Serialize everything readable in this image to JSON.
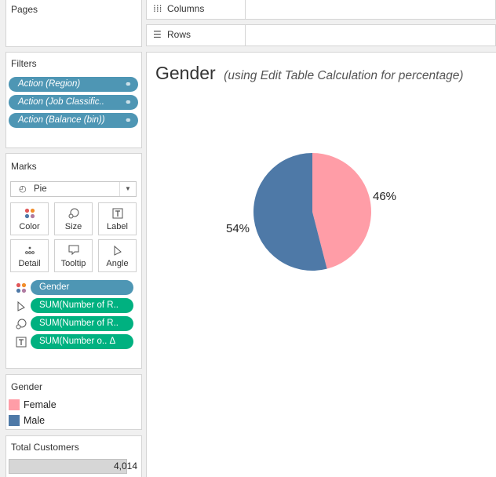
{
  "pages": {
    "title": "Pages"
  },
  "shelves": {
    "columns": {
      "icon": "columns-icon",
      "label": "Columns"
    },
    "rows": {
      "icon": "rows-icon",
      "label": "Rows"
    }
  },
  "filters": {
    "title": "Filters",
    "items": [
      {
        "label": "Action (Region)"
      },
      {
        "label": "Action (Job Classific.."
      },
      {
        "label": "Action (Balance (bin))"
      }
    ]
  },
  "marks": {
    "title": "Marks",
    "type": "Pie",
    "buttons": [
      {
        "label": "Color",
        "icon": "color-dots-icon"
      },
      {
        "label": "Size",
        "icon": "size-icon"
      },
      {
        "label": "Label",
        "icon": "label-icon"
      },
      {
        "label": "Detail",
        "icon": "detail-icon"
      },
      {
        "label": "Tooltip",
        "icon": "tooltip-icon"
      },
      {
        "label": "Angle",
        "icon": "angle-icon"
      }
    ],
    "pills": [
      {
        "label": "Gender",
        "icon": "color-dots-icon",
        "color": "#4e96b4"
      },
      {
        "label": "SUM(Number of R..",
        "icon": "angle-icon",
        "color": "#00b180"
      },
      {
        "label": "SUM(Number of R..",
        "icon": "size-icon",
        "color": "#00b180"
      },
      {
        "label": "SUM(Number o.. Δ",
        "icon": "label-icon",
        "color": "#00b180"
      }
    ]
  },
  "gender_legend": {
    "title": "Gender",
    "items": [
      {
        "label": "Female",
        "color": "#ff9da7"
      },
      {
        "label": "Male",
        "color": "#4e79a7"
      }
    ]
  },
  "total_customers": {
    "title": "Total Customers",
    "value": "4,014"
  },
  "view": {
    "title": "Gender",
    "subtitle": "(using Edit Table Calculation for percentage)"
  },
  "chart_data": {
    "type": "pie",
    "categories": [
      "Female",
      "Male"
    ],
    "values": [
      46,
      54
    ],
    "labels": [
      "46%",
      "54%"
    ],
    "colors": [
      "#ff9da7",
      "#4e79a7"
    ]
  }
}
